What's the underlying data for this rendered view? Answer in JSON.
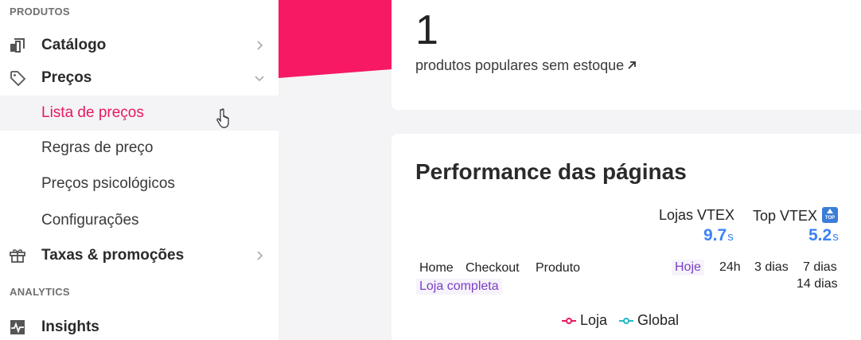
{
  "sidebar": {
    "sections": [
      {
        "label": "PRODUTOS"
      },
      {
        "label": "ANALYTICS"
      }
    ],
    "items": [
      {
        "label": "Catálogo",
        "icon": "catalog-icon"
      },
      {
        "label": "Preços",
        "icon": "tag-icon",
        "expanded": true
      },
      {
        "label": "Taxas & promoções",
        "icon": "gift-icon"
      },
      {
        "label": "Insights",
        "icon": "pulse-icon"
      }
    ],
    "subitems": [
      {
        "label": "Lista de preços",
        "active": true
      },
      {
        "label": "Regras de preço"
      },
      {
        "label": "Preços psicológicos"
      },
      {
        "label": "Configurações"
      }
    ]
  },
  "main": {
    "stock_card": {
      "count": "1",
      "link_text": "produtos populares sem estoque",
      "link_icon": "arrow-up-right-icon"
    },
    "performance": {
      "title": "Performance das páginas",
      "columns": [
        {
          "label": "Lojas VTEX",
          "value": "9.7",
          "unit": "s"
        },
        {
          "label": "Top VTEX",
          "value": "5.2",
          "unit": "s",
          "badge": "TOP"
        }
      ],
      "page_tabs": [
        "Home",
        "Checkout",
        "Produto",
        "Loja completa"
      ],
      "selected_page_tab": "Loja completa",
      "period_tabs": [
        "Hoje",
        "24h",
        "3 dias",
        "7 dias",
        "14 dias"
      ],
      "selected_period_tab": "Hoje",
      "legend": [
        {
          "label": "Loja",
          "color": "#e8195e"
        },
        {
          "label": "Global",
          "color": "#1fb8c9"
        }
      ]
    }
  },
  "colors": {
    "accent": "#e8195e",
    "metric_blue": "#3b82f6",
    "selected_tab": "#7b3fc4"
  }
}
